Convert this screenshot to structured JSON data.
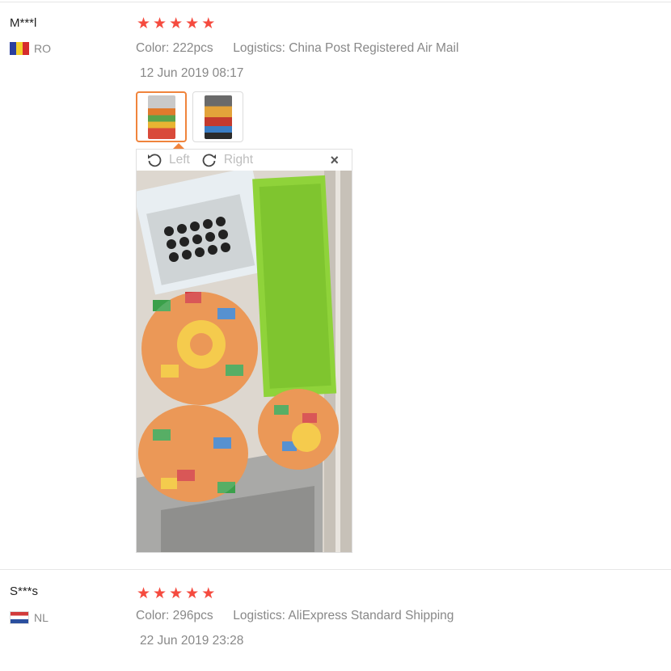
{
  "reviews": [
    {
      "user": "M***l",
      "country": "RO",
      "flag_colors": [
        "#2a3f9e",
        "#f3cf2b",
        "#d62b2b"
      ],
      "stars": [
        "★",
        "★",
        "★",
        "★",
        "★"
      ],
      "color_label": "Color:",
      "color_value": "222pcs",
      "logistics_label": "Logistics:",
      "logistics_value": "China Post Registered Air Mail",
      "date": "12 Jun 2019 08:17",
      "viewer": {
        "rotate_left": "Left",
        "rotate_right": "Right",
        "close": "×"
      }
    },
    {
      "user": "S***s",
      "country": "NL",
      "flag_colors": [
        "#d13a3a",
        "#ffffff",
        "#2a4f9e"
      ],
      "stars": [
        "★",
        "★",
        "★",
        "★",
        "★"
      ],
      "color_label": "Color:",
      "color_value": "296pcs",
      "logistics_label": "Logistics:",
      "logistics_value": "AliExpress Standard Shipping",
      "date": "22 Jun 2019 23:28"
    }
  ],
  "colors": {
    "star": "#f54b3f",
    "accent": "#f0843c",
    "muted": "#888888"
  },
  "icons": {
    "rotate_left": "rotate-left-icon",
    "rotate_right": "rotate-right-icon",
    "close": "close-icon"
  }
}
